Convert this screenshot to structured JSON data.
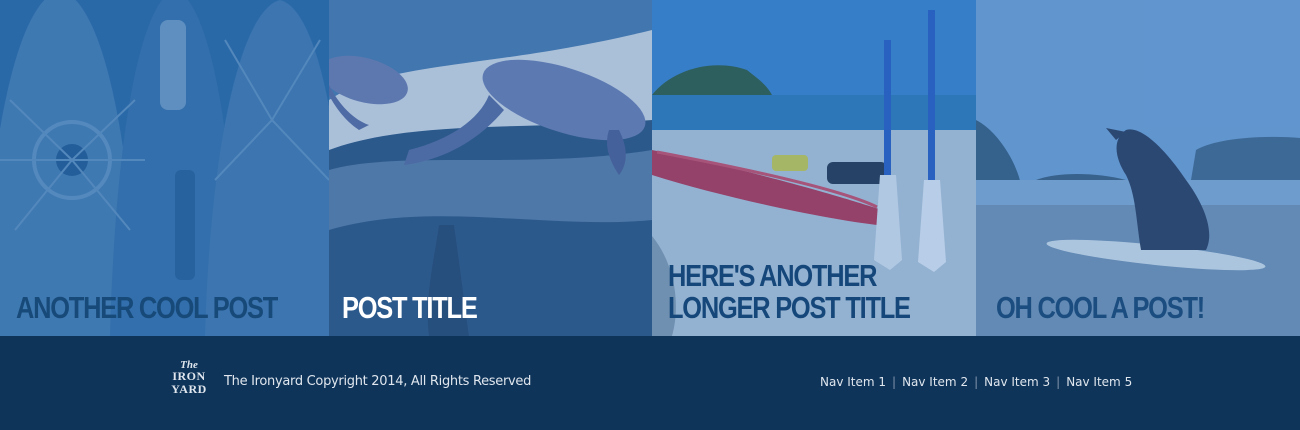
{
  "posts": [
    {
      "title": "ANOTHER COOL POST",
      "image": "surfboards-image"
    },
    {
      "title": "POST TITLE",
      "image": "dolphins-image"
    },
    {
      "title_line1": "HERE'S ANOTHER",
      "title_line2": "LONGER POST TITLE",
      "image": "kayak-beach-image"
    },
    {
      "title": "OH COOL A POST!",
      "image": "dog-surfboard-image"
    }
  ],
  "footer": {
    "logo": {
      "line1": "The",
      "line2": "IRON",
      "line3": "YARD"
    },
    "copyright": "The Ironyard Copyright 2014, All Rights Reserved",
    "nav": [
      "Nav Item 1",
      "Nav Item 2",
      "Nav Item 3",
      "Nav Item 5"
    ],
    "separator": "|"
  },
  "colors": {
    "footer_bg": "#0f3459",
    "tile_tint": "#1f5c9e",
    "title_dark": "#174a79",
    "title_light": "#ffffff"
  }
}
